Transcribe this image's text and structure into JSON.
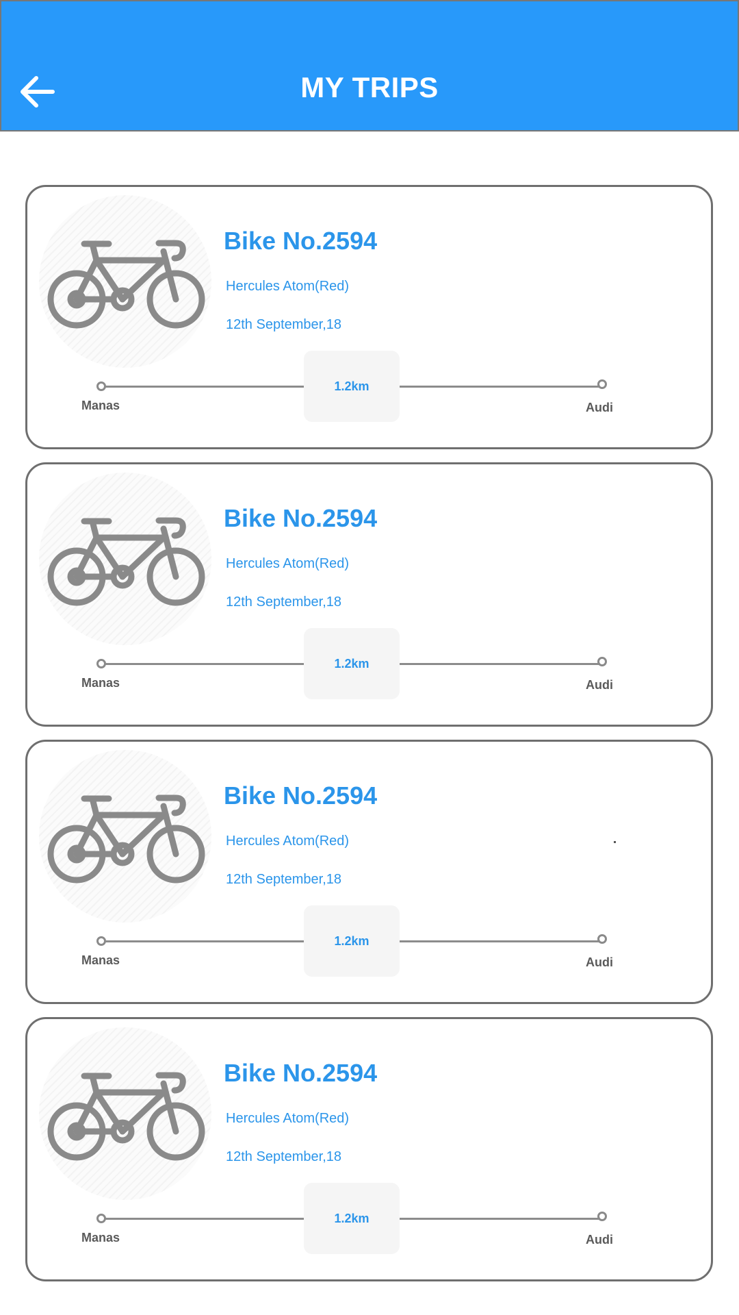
{
  "header": {
    "title": "MY TRIPS",
    "back_icon": "arrow-left-icon",
    "background_color": "#2899fa"
  },
  "colors": {
    "accent": "#2b95ea",
    "card_border": "#6f6f6f",
    "icon_gray": "#8a8a8a"
  },
  "trips": [
    {
      "bike_title": "Bike No.2594",
      "model": "Hercules Atom(Red)",
      "date": "12th September,18",
      "distance": "1.2km",
      "from": "Manas",
      "to": "Audi",
      "icon": "bicycle-icon"
    },
    {
      "bike_title": "Bike No.2594",
      "model": "Hercules Atom(Red)",
      "date": "12th September,18",
      "distance": "1.2km",
      "from": "Manas",
      "to": "Audi",
      "icon": "bicycle-icon"
    },
    {
      "bike_title": "Bike No.2594",
      "model": "Hercules Atom(Red)",
      "date": "12th September,18",
      "distance": "1.2km",
      "from": "Manas",
      "to": "Audi",
      "icon": "bicycle-icon"
    },
    {
      "bike_title": "Bike No.2594",
      "model": "Hercules Atom(Red)",
      "date": "12th September,18",
      "distance": "1.2km",
      "from": "Manas",
      "to": "Audi",
      "icon": "bicycle-icon"
    }
  ]
}
